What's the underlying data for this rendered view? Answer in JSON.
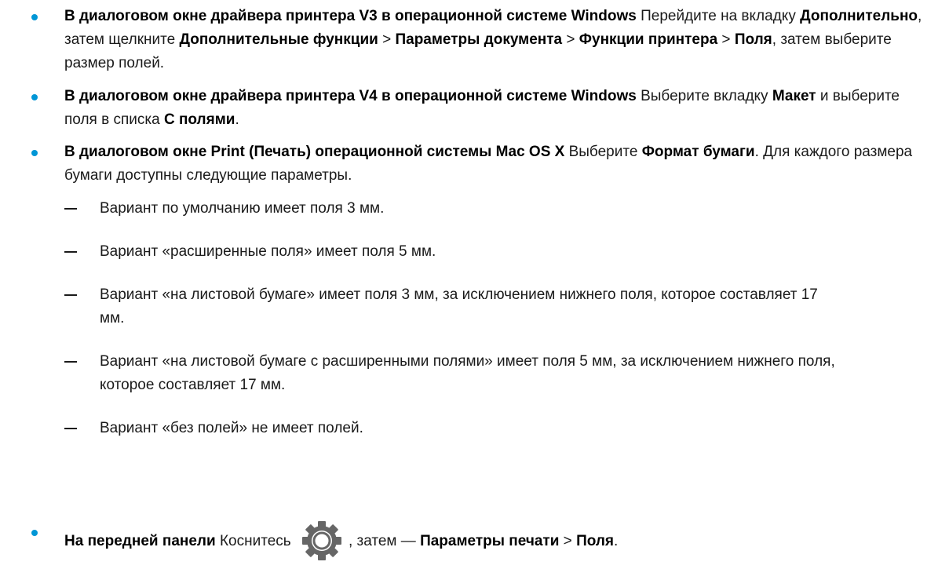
{
  "colors": {
    "bullet": "#0096d6",
    "text": "#1a1a1a",
    "gear": "#666666"
  },
  "items": [
    {
      "parts": [
        {
          "t": "В диалоговом окне драйвера принтера V3 в операционной системе Windows",
          "b": true
        },
        {
          "t": " Перейдите на вкладку ",
          "b": false
        },
        {
          "t": "Дополнительно",
          "b": true
        },
        {
          "t": ", затем щелкните ",
          "b": false
        },
        {
          "t": "Дополнительные функции",
          "b": true
        },
        {
          "t": " > ",
          "b": false
        },
        {
          "t": "Параметры документа",
          "b": true
        },
        {
          "t": " > ",
          "b": false
        },
        {
          "t": "Функции принтера",
          "b": true
        },
        {
          "t": " > ",
          "b": false
        },
        {
          "t": "Поля",
          "b": true
        },
        {
          "t": ", затем выберите размер полей.",
          "b": false
        }
      ]
    },
    {
      "parts": [
        {
          "t": "В диалоговом окне драйвера принтера V4 в операционной системе Windows",
          "b": true
        },
        {
          "t": " Выберите вкладку ",
          "b": false
        },
        {
          "t": "Макет",
          "b": true
        },
        {
          "t": " и выберите поля в списка ",
          "b": false
        },
        {
          "t": "С полями",
          "b": true
        },
        {
          "t": ".",
          "b": false
        }
      ]
    },
    {
      "parts": [
        {
          "t": "В диалоговом окне Print (Печать) операционной системы Mac OS X",
          "b": true
        },
        {
          "t": " Выберите ",
          "b": false
        },
        {
          "t": "Формат бумаги",
          "b": true
        },
        {
          "t": ". Для каждого размера бумаги доступны следующие параметры.",
          "b": false
        }
      ]
    }
  ],
  "subitems": [
    "Вариант по умолчанию имеет поля 3 мм.",
    "Вариант «расширенные поля» имеет поля 5 мм.",
    "Вариант «на листовой бумаге» имеет поля 3 мм, за исключением нижнего поля, которое составляет 17 мм.",
    "Вариант «на листовой бумаге с расширенными полями» имеет поля 5 мм, за исключением нижнего поля, которое составляет 17 мм.",
    "Вариант «без полей» не имеет полей."
  ],
  "panel_item": {
    "lead": "На передней панели",
    "text1": " Коснитесь ",
    "gear_icon": "settings-gear-icon",
    "text2": ", затем — ",
    "menu1": "Параметры печати",
    "sep": " > ",
    "menu2": "Поля",
    "end": "."
  }
}
